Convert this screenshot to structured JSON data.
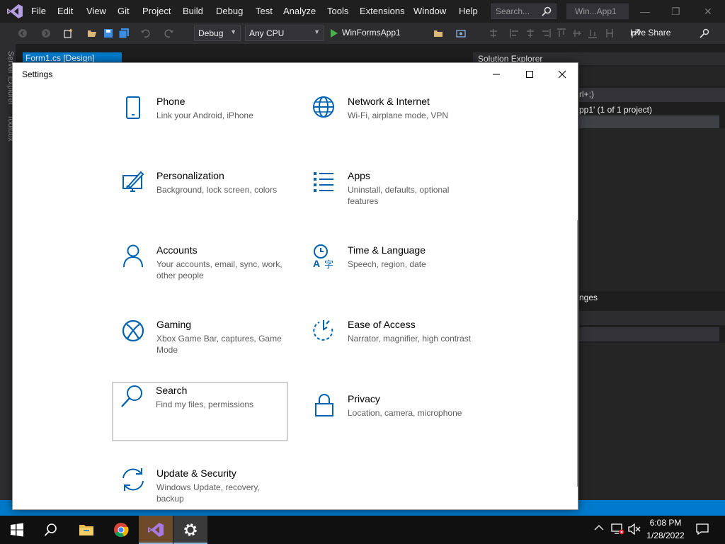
{
  "vs": {
    "menu": [
      "File",
      "Edit",
      "View",
      "Git",
      "Project",
      "Build",
      "Debug",
      "Test",
      "Analyze",
      "Tools",
      "Extensions",
      "Window",
      "Help"
    ],
    "search_placeholder": "Search...",
    "window_title": "Win...App1",
    "toolbar": {
      "config": "Debug",
      "platform": "Any CPU",
      "run_target": "WinFormsApp1",
      "live_share": "Live Share"
    },
    "doc_tab": "Form1.cs [Design]",
    "side_tabs": [
      "Server Explorer",
      "Toolbox"
    ],
    "solution_explorer": {
      "title": "Solution Explorer",
      "search_hint": "rl+;)",
      "solution_line": "pp1' (1 of 1 project)",
      "changes_label": "nges"
    },
    "accent": "#007acc"
  },
  "settings": {
    "title": "Settings",
    "icon_color": "#0063b1",
    "tiles": [
      {
        "title": "Phone",
        "desc": "Link your Android, iPhone",
        "icon": "phone-icon"
      },
      {
        "title": "Network & Internet",
        "desc": "Wi-Fi, airplane mode, VPN",
        "icon": "globe-icon"
      },
      {
        "title": "Personalization",
        "desc": "Background, lock screen, colors",
        "icon": "paint-icon"
      },
      {
        "title": "Apps",
        "desc": "Uninstall, defaults, optional features",
        "icon": "apps-list-icon"
      },
      {
        "title": "Accounts",
        "desc": "Your accounts, email, sync, work, other people",
        "icon": "person-icon"
      },
      {
        "title": "Time & Language",
        "desc": "Speech, region, date",
        "icon": "time-language-icon"
      },
      {
        "title": "Gaming",
        "desc": "Xbox Game Bar, captures, Game Mode",
        "icon": "xbox-icon"
      },
      {
        "title": "Ease of Access",
        "desc": "Narrator, magnifier, high contrast",
        "icon": "ease-of-access-icon"
      },
      {
        "title": "Search",
        "desc": "Find my files, permissions",
        "icon": "search-icon"
      },
      {
        "title": "Privacy",
        "desc": "Location, camera, microphone",
        "icon": "lock-icon"
      },
      {
        "title": "Update & Security",
        "desc": "Windows Update, recovery, backup",
        "icon": "sync-icon"
      }
    ]
  },
  "taskbar": {
    "time": "6:08 PM",
    "date": "1/28/2022",
    "apps": [
      "start-icon",
      "search-icon",
      "file-explorer-icon",
      "chrome-icon",
      "visual-studio-icon",
      "settings-gear-icon"
    ]
  }
}
